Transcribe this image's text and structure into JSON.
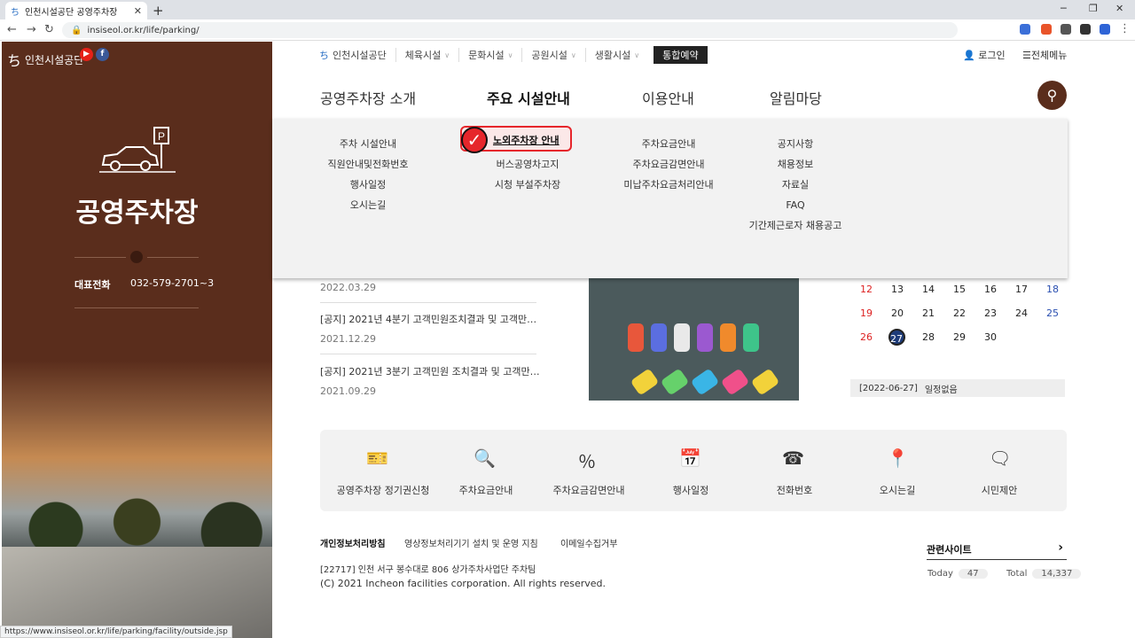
{
  "browser": {
    "tab_title": "인천시설공단 공영주차장",
    "url": "insiseol.or.kr/life/parking/",
    "status_url": "https://www.insiseol.or.kr/life/parking/facility/outside.jsp"
  },
  "sidebar": {
    "logo": "인천시설공단",
    "title": "공영주차장",
    "phone_label": "대표전화",
    "phone": "032-579-2701~3"
  },
  "topnav": {
    "brand": "인천시설공단",
    "items": [
      "체육시설",
      "문화시설",
      "공원시설",
      "생활시설"
    ],
    "booking": "통합예약",
    "login": "로그인",
    "allmenu": "전체메뉴"
  },
  "mainmenu": [
    "공영주차장 소개",
    "주요 시설안내",
    "이용안내",
    "알림마당"
  ],
  "mega": {
    "col1": [
      "주차 시설안내",
      "직원안내및전화번호",
      "행사일정",
      "오시는길"
    ],
    "col2_highlight": "노외주차장 안내",
    "col2": [
      "버스공영차고지",
      "시청 부설주차장"
    ],
    "col3": [
      "주차요금안내",
      "주차요금감면안내",
      "미납주차요금처리안내"
    ],
    "col4": [
      "공지사항",
      "채용정보",
      "자료실",
      "FAQ",
      "기간제근로자 채용공고"
    ]
  },
  "notices": [
    {
      "date": "2022.03.29"
    },
    {
      "title": "[공지] 2021년 4분기 고객민원조치결과 및 고객만…",
      "date": "2021.12.29"
    },
    {
      "title": "[공지] 2021년 3분기 고객민원 조치결과 및 고객만…",
      "date": "2021.09.29"
    }
  ],
  "calendar": {
    "rows": [
      [
        "12",
        "13",
        "14",
        "15",
        "16",
        "17",
        "18"
      ],
      [
        "19",
        "20",
        "21",
        "22",
        "23",
        "24",
        "25"
      ],
      [
        "26",
        "27",
        "28",
        "29",
        "30",
        "",
        ""
      ]
    ],
    "today": "27",
    "schedule_date": "[2022-06-27]",
    "schedule_text": "일정없음"
  },
  "quick": [
    "공영주차장 정기권신청",
    "주차요금안내",
    "주차요금감면안내",
    "행사일정",
    "전화번호",
    "오시는길",
    "시민제안"
  ],
  "footer": {
    "links": [
      "개인정보처리방침",
      "영상정보처리기기 설치 및 운영 지침",
      "이메일수집거부"
    ],
    "address": "[22717] 인천 서구 봉수대로 806 상가주차사업단 주차팀",
    "copyright": "(C) 2021 Incheon facilities corporation. All rights reserved.",
    "related": "관련사이트",
    "today_label": "Today",
    "today_count": "47",
    "total_label": "Total",
    "total_count": "14,337"
  },
  "colors": {
    "brand": "#5a2d1c",
    "highlight": "#e6262b",
    "today": "#1e3c7a"
  }
}
